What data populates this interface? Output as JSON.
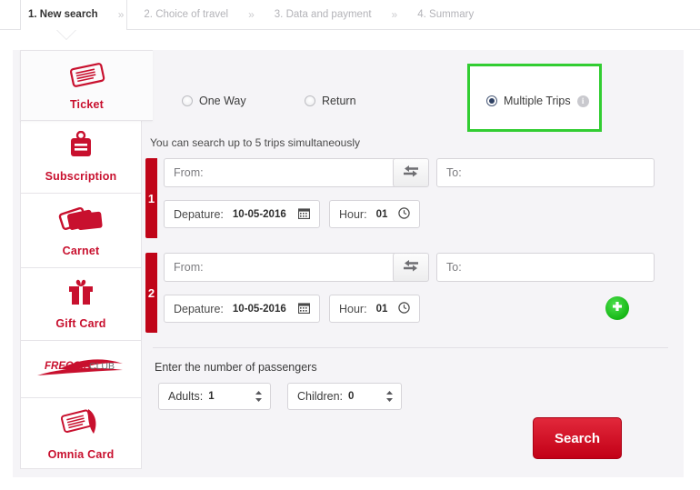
{
  "steps": {
    "separator": "»",
    "items": [
      {
        "label": "1. New search",
        "active": true
      },
      {
        "label": "2. Choice of travel",
        "active": false
      },
      {
        "label": "3. Data and payment",
        "active": false
      },
      {
        "label": "4. Summary",
        "active": false
      }
    ]
  },
  "sidebar": {
    "items": [
      {
        "label": "Ticket",
        "icon": "ticket-icon",
        "active": true
      },
      {
        "label": "Subscription",
        "icon": "subscription-badge-icon",
        "active": false
      },
      {
        "label": "Carnet",
        "icon": "carnet-cards-icon",
        "active": false
      },
      {
        "label": "Gift Card",
        "icon": "gift-box-icon",
        "active": false
      },
      {
        "label": "",
        "icon": "freccia-club-logo",
        "logo_text_1": "FRECCIA",
        "logo_text_2": "CLUB",
        "active": false
      },
      {
        "label": "Omnia Card",
        "icon": "omnia-card-icon",
        "active": false
      }
    ]
  },
  "trip_type": {
    "options": [
      {
        "label": "One Way",
        "selected": false
      },
      {
        "label": "Return",
        "selected": false
      },
      {
        "label": "Multiple Trips",
        "selected": true,
        "info_icon": "info-icon",
        "info_glyph": "i",
        "highlighted": true
      }
    ]
  },
  "form": {
    "hint": "You can search up to 5 trips simultaneously",
    "from_placeholder": "From:",
    "to_placeholder": "To:",
    "departure_label": "Depature:",
    "hour_label": "Hour:",
    "swap_icon": "swap-arrows-icon",
    "calendar_icon": "calendar-icon",
    "clock_icon": "clock-icon",
    "add_trip_icon": "plus-circle-icon",
    "trips": [
      {
        "number": "1",
        "from": "",
        "to": "",
        "date": "10-05-2016",
        "hour": "01"
      },
      {
        "number": "2",
        "from": "",
        "to": "",
        "date": "10-05-2016",
        "hour": "01"
      }
    ]
  },
  "passengers": {
    "title": "Enter the number of passengers",
    "adults_label": "Adults:",
    "adults_value": "1",
    "children_label": "Children:",
    "children_value": "0"
  },
  "actions": {
    "search_label": "Search"
  },
  "colors": {
    "brand_red": "#c8102e",
    "tab_red": "#c00418",
    "highlight_green": "#32cd32",
    "add_green": "#16b716",
    "panel_bg": "#f5f4f7"
  }
}
